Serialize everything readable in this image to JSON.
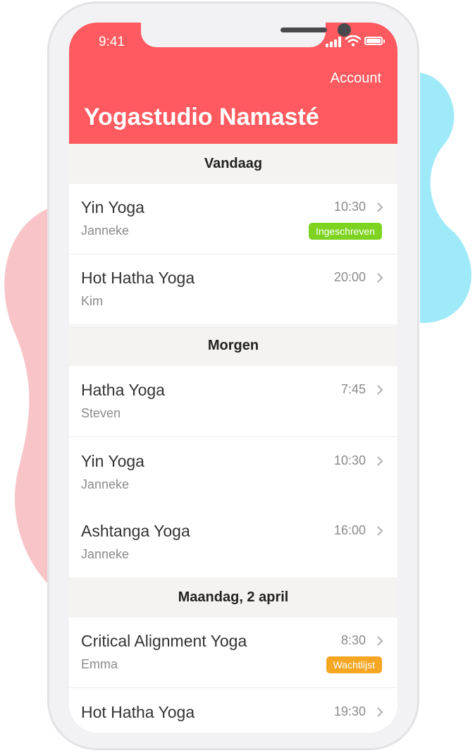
{
  "status_bar": {
    "time": "9:41"
  },
  "header": {
    "account_label": "Account",
    "title": "Yogastudio Namasté"
  },
  "sections": [
    {
      "label": "Vandaag",
      "classes": [
        {
          "name": "Yin Yoga",
          "teacher": "Janneke",
          "time": "10:30",
          "badge": "Ingeschreven"
        },
        {
          "name": "Hot Hatha Yoga",
          "teacher": "Kim",
          "time": "20:00"
        }
      ]
    },
    {
      "label": "Morgen",
      "classes": [
        {
          "name": "Hatha Yoga",
          "teacher": "Steven",
          "time": "7:45"
        },
        {
          "name": "Yin Yoga",
          "teacher": "Janneke",
          "time": "10:30"
        },
        {
          "name": "Ashtanga Yoga",
          "teacher": "Janneke",
          "time": "16:00"
        }
      ]
    },
    {
      "label": "Maandag, 2 april",
      "classes": [
        {
          "name": "Critical Alignment Yoga",
          "teacher": "Emma",
          "time": "8:30",
          "badge": "Wachtlijst"
        },
        {
          "name": "Hot Hatha Yoga",
          "teacher": "",
          "time": "19:30"
        }
      ]
    }
  ],
  "colors": {
    "brand": "#ff5a5f",
    "registered": "#7ed321",
    "waitlist": "#f5a623",
    "section_bg": "#f4f3f1"
  },
  "icons": [
    "signal-icon",
    "wifi-icon",
    "battery-icon",
    "chevron-right-icon"
  ]
}
